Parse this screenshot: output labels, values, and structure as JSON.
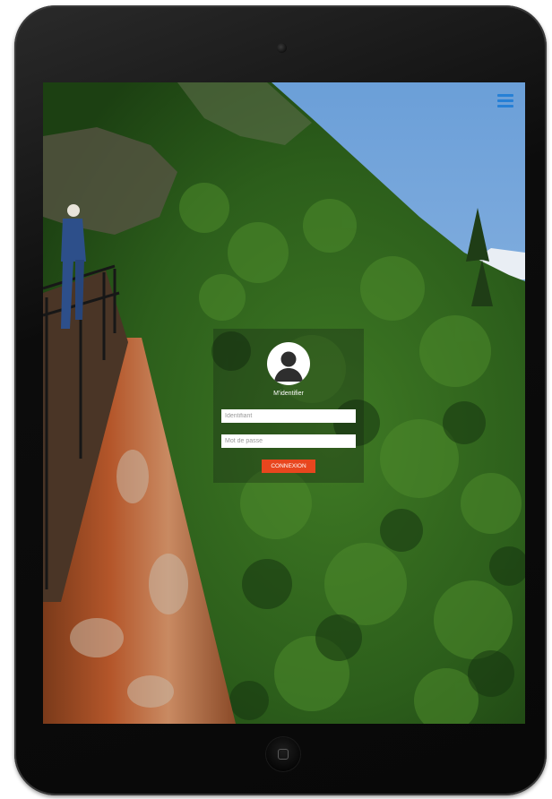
{
  "login": {
    "title": "M'identifier",
    "username_placeholder": "Identifiant",
    "password_placeholder": "Mot de passe",
    "submit_label": "CONNEXION"
  },
  "icons": {
    "menu": "hamburger-menu-icon",
    "avatar": "user-avatar-icon"
  },
  "colors": {
    "menu_icon": "#2680d6",
    "submit_button": "#e8461e",
    "device_frame": "#0c0c0c"
  }
}
